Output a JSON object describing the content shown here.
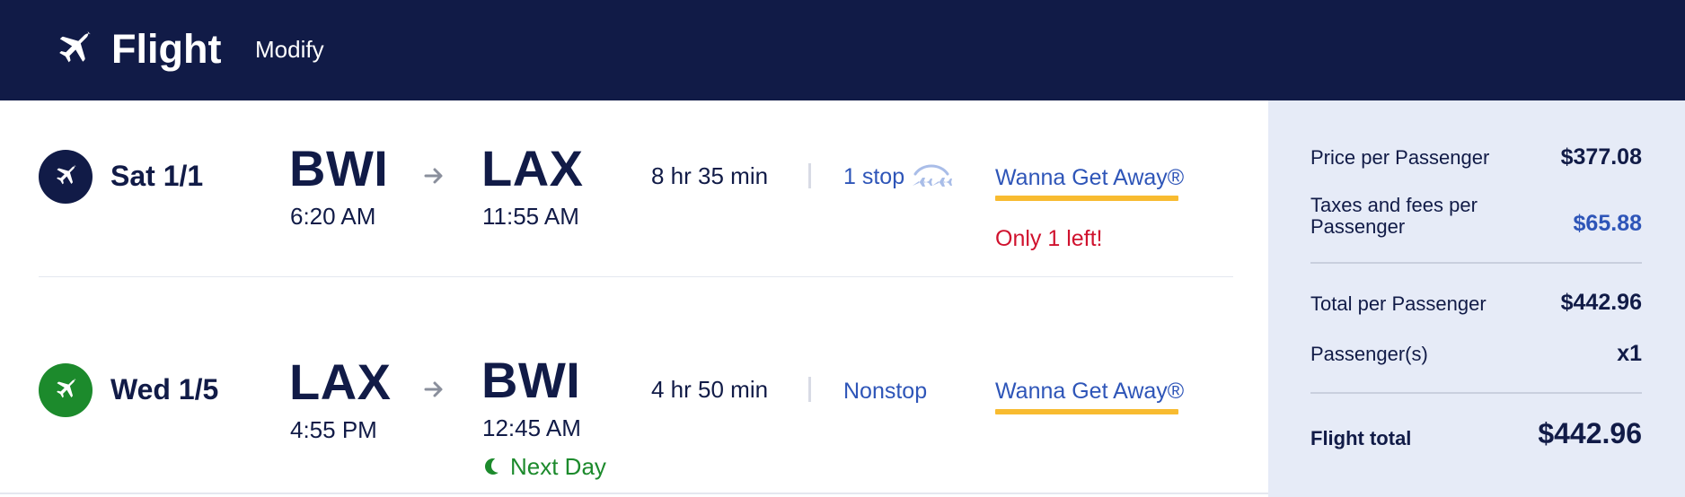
{
  "header": {
    "title": "Flight",
    "modify_label": "Modify",
    "icon": "plane-icon"
  },
  "flights": [
    {
      "badge_icon": "plane-icon",
      "badge_color": "#111b47",
      "date": "Sat 1/1",
      "origin": "BWI",
      "depart_time": "6:20 AM",
      "destination": "LAX",
      "arrive_time": "11:55 AM",
      "duration": "8 hr 35 min",
      "stops": "1 stop",
      "stops_icon": "connecting-planes-icon",
      "fare_class": "Wanna Get Away®",
      "availability": "Only 1 left!"
    },
    {
      "badge_icon": "plane-icon",
      "badge_color": "#1c8a2c",
      "date": "Wed 1/5",
      "origin": "LAX",
      "depart_time": "4:55 PM",
      "destination": "BWI",
      "arrive_time": "12:45 AM",
      "arrival_note": "Next Day",
      "arrival_note_icon": "moon-icon",
      "duration": "4 hr 50 min",
      "stops": "Nonstop",
      "fare_class": "Wanna Get Away®"
    }
  ],
  "summary": {
    "price_per_passenger_label": "Price per Passenger",
    "price_per_passenger": "$377.08",
    "taxes_label": "Taxes and fees per Passenger",
    "taxes": "$65.88",
    "total_per_passenger_label": "Total per Passenger",
    "total_per_passenger": "$442.96",
    "passengers_label": "Passenger(s)",
    "passengers": "x1",
    "flight_total_label": "Flight total",
    "flight_total": "$442.96"
  },
  "colors": {
    "navy": "#111b47",
    "link_blue": "#2e55b8",
    "fare_gold": "#f8bb30",
    "alert_red": "#d0122e",
    "next_day_green": "#1c8a2c",
    "sidebar_bg": "#e6ebf7"
  }
}
